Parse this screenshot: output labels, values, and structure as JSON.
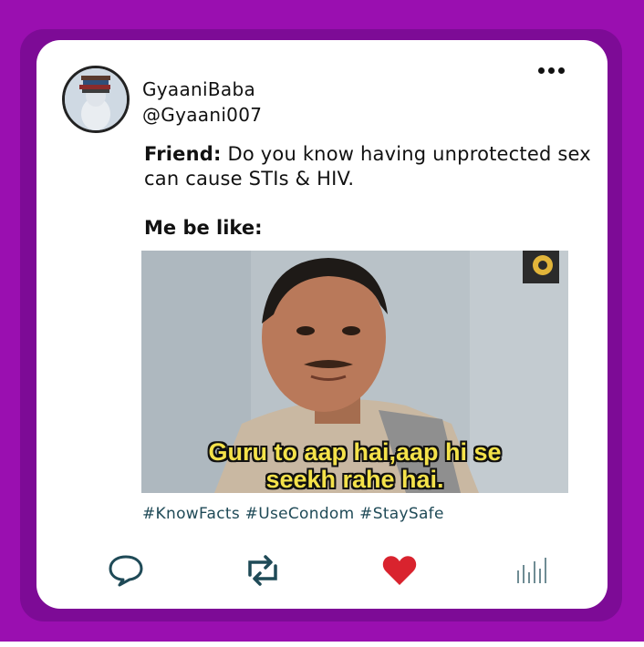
{
  "post": {
    "display_name": "GyaaniBaba",
    "handle": "@Gyaani007",
    "friend_label": "Friend:",
    "friend_text": " Do you know having unprotected sex can cause STIs & HIV.",
    "caption": "Me be like:",
    "meme_subtitle_line1": "Guru to aap hai,aap hi se",
    "meme_subtitle_line2": "seekh rahe hai.",
    "hashtags": "#KnowFacts #UseCondom #StaySafe"
  },
  "actions": {
    "reply_icon": "speech-bubble-icon",
    "retweet_icon": "retweet-arrows-icon",
    "like_icon": "heart-icon",
    "stats_icon": "bar-chart-icon"
  },
  "colors": {
    "frame": "#9a0fb0",
    "frame_shadow": "#7d0b96",
    "icon_teal": "#1f4a57",
    "heart_red": "#d9232e",
    "subtitle_yellow": "#f4e24a"
  }
}
